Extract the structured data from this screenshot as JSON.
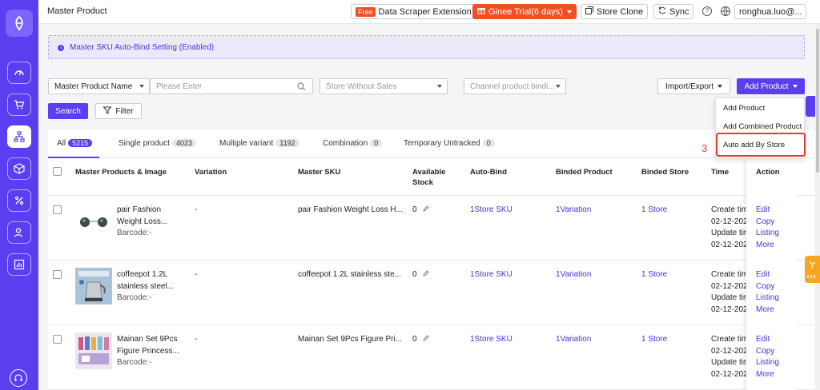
{
  "topbar": {
    "title": "Master Product",
    "free_tag": "Free",
    "scraper": "Data Scraper Extension",
    "trial": "Ginee Trial(6 days)",
    "store_clone": "Store Clone",
    "sync": "Sync",
    "user": "ronghua.luo@..."
  },
  "banner": {
    "text": "Master SKU Auto-Bind Setting (Enabled)"
  },
  "filters": {
    "field_select": "Master Product Name",
    "search_placeholder": "Please Enter",
    "store_select": "Store Without Sales",
    "channel_select": "Channel product bindi...",
    "search_button": "Search",
    "filter_button": "Filter",
    "import_export": "Import/Export",
    "add_product": "Add Product"
  },
  "add_menu": {
    "items": [
      "Add Product",
      "Add Combined Product",
      "Auto add By Store"
    ],
    "step_marker": "3"
  },
  "tabs": [
    {
      "label": "All",
      "count": "5215"
    },
    {
      "label": "Single product",
      "count": "4023"
    },
    {
      "label": "Multiple variant",
      "count": "1192"
    },
    {
      "label": "Combination",
      "count": "0"
    },
    {
      "label": "Temporary Untracked",
      "count": "0"
    }
  ],
  "columns": {
    "product": "Master Products & Image",
    "variation": "Variation",
    "sku": "Master SKU",
    "stock_1": "Available",
    "stock_2": "Stock",
    "auto_bind": "Auto-Bind",
    "binded_product": "Binded Product",
    "binded_store": "Binded Store",
    "time": "Time",
    "action": "Action"
  },
  "rows": [
    {
      "name_1": "pair Fashion",
      "name_2": "Weight Loss...",
      "barcode": "Barcode:-",
      "variation": "-",
      "sku": "pair Fashion Weight Loss H...",
      "stock": "0",
      "auto_bind": "1Store SKU",
      "binded_product": "1Variation",
      "binded_store": "1 Store",
      "create_label": "Create tim",
      "create_date": "02-12-202",
      "update_label": "Update tim",
      "update_date": "02-12-202",
      "edit": "Edit",
      "copy": "Copy Listing",
      "more": "More"
    },
    {
      "name_1": "coffeepot 1.2L",
      "name_2": "stainless steel...",
      "barcode": "Barcode:-",
      "variation": "-",
      "sku": "coffeepot 1.2L stainless ste...",
      "stock": "0",
      "auto_bind": "1Store SKU",
      "binded_product": "1Variation",
      "binded_store": "1 Store",
      "create_label": "Create tim",
      "create_date": "02-12-202",
      "update_label": "Update tim",
      "update_date": "02-12-202",
      "edit": "Edit",
      "copy": "Copy Listing",
      "more": "More"
    },
    {
      "name_1": "Mainan Set 9Pcs",
      "name_2": "Figure Princess...",
      "barcode": "Barcode:-",
      "variation": "-",
      "sku": "Mainan Set 9Pcs Figure Pri...",
      "stock": "0",
      "auto_bind": "1Store SKU",
      "binded_product": "1Variation",
      "binded_store": "1 Store",
      "create_label": "Create tim",
      "create_date": "02-12-202",
      "update_label": "Update tim",
      "update_date": "02-12-202",
      "edit": "Edit",
      "copy": "Copy Listing",
      "more": "More"
    }
  ],
  "colors": {
    "brand": "#5b3ef0",
    "link": "#4a33d6",
    "alert": "#e53935",
    "trial": "#f04e23"
  }
}
